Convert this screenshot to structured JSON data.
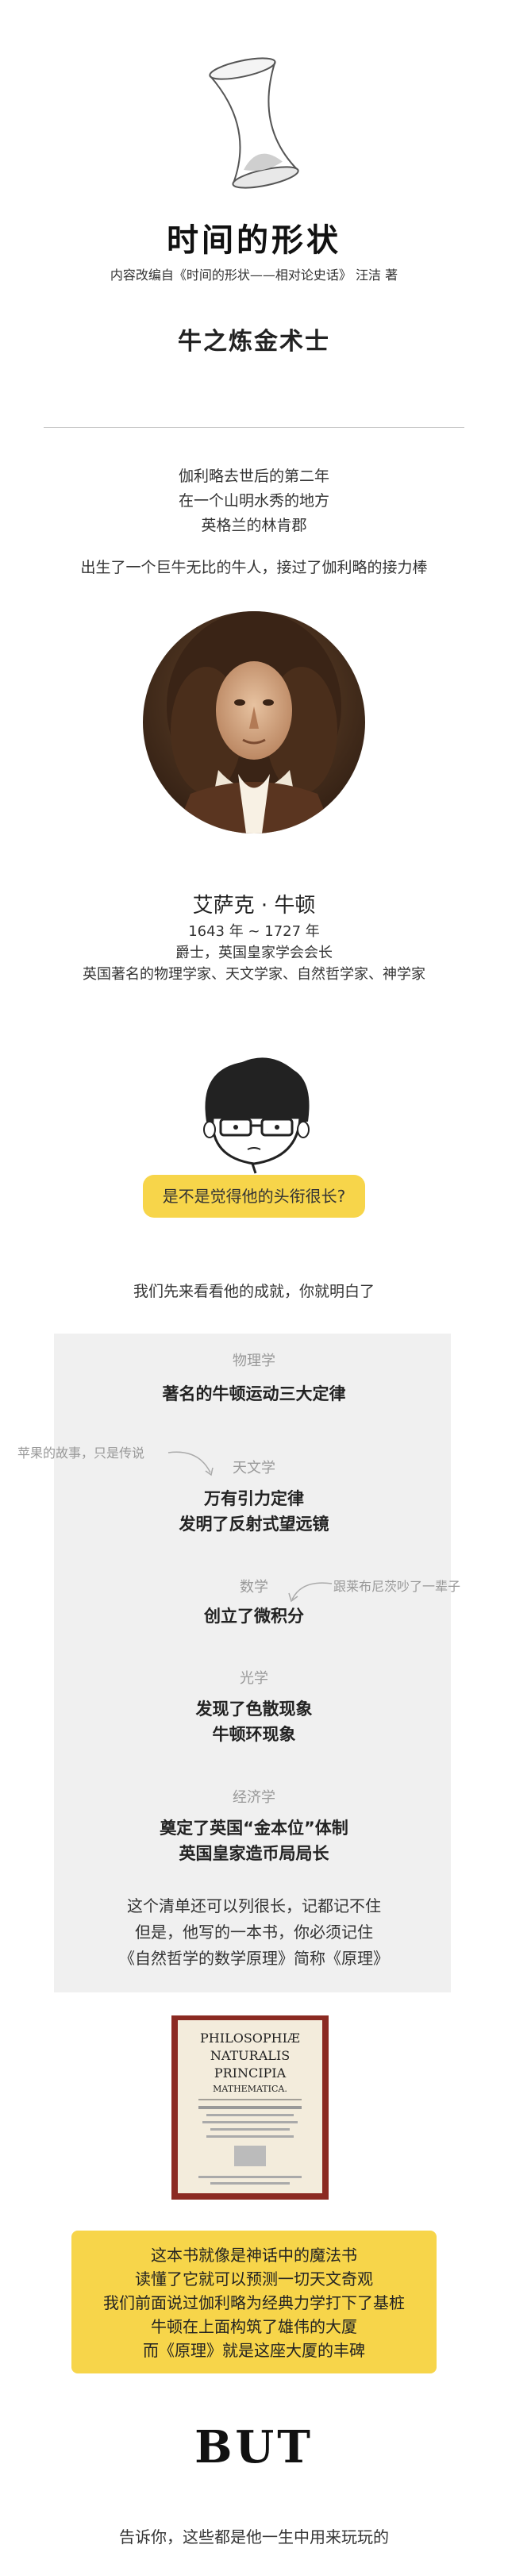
{
  "header": {
    "title": "时间的形状",
    "subtitle": "内容改编自《时间的形状——相对论史话》 汪洁 著",
    "chapter": "牛之炼金术士"
  },
  "intro": {
    "lines": [
      "伽利略去世后的第二年",
      "在一个山明水秀的地方",
      "英格兰的林肯郡"
    ],
    "line2": "出生了一个巨牛无比的牛人，接过了伽利略的接力棒"
  },
  "person": {
    "name": "艾萨克 · 牛顿",
    "years": "1643 年 ~ 1727 年",
    "title": "爵士，英国皇家学会会长",
    "roles": "英国著名的物理学家、天文学家、自然哲学家、神学家"
  },
  "bubble": "是不是觉得他的头衔很长?",
  "lead": "我们先来看看他的成就，你就明白了",
  "achievements": [
    {
      "category": "物理学",
      "items": [
        "著名的牛顿运动三大定律"
      ]
    },
    {
      "category": "天文学",
      "items": [
        "万有引力定律",
        "发明了反射式望远镜"
      ]
    },
    {
      "category": "数学",
      "items": [
        "创立了微积分"
      ]
    },
    {
      "category": "光学",
      "items": [
        "发现了色散现象",
        "牛顿环现象"
      ]
    },
    {
      "category": "经济学",
      "items": [
        "奠定了英国“金本位”体制",
        "英国皇家造币局局长"
      ]
    }
  ],
  "notes": {
    "apple": "苹果的故事，只是传说",
    "leibniz": "跟莱布尼茨吵了一辈子"
  },
  "summary": [
    "这个清单还可以列很长，记都记不住",
    "但是，他写的一本书，你必须记住",
    "《自然哲学的数学原理》简称《原理》"
  ],
  "book": {
    "l1": "PHILOSOPHIÆ",
    "l2": "NATURALIS",
    "l3": "PRINCIPIA",
    "l4": "MATHEMATICA."
  },
  "yellow_box": [
    "这本书就像是神话中的魔法书",
    "读懂了它就可以预测一切天文奇观",
    "我们前面说过伽利略为经典力学打下了基桩",
    "牛顿在上面构筑了雄伟的大厦",
    "而《原理》就是这座大厦的丰碑"
  ],
  "but": "BUT",
  "footer": "告诉你，这些都是他一生中用来玩玩的"
}
